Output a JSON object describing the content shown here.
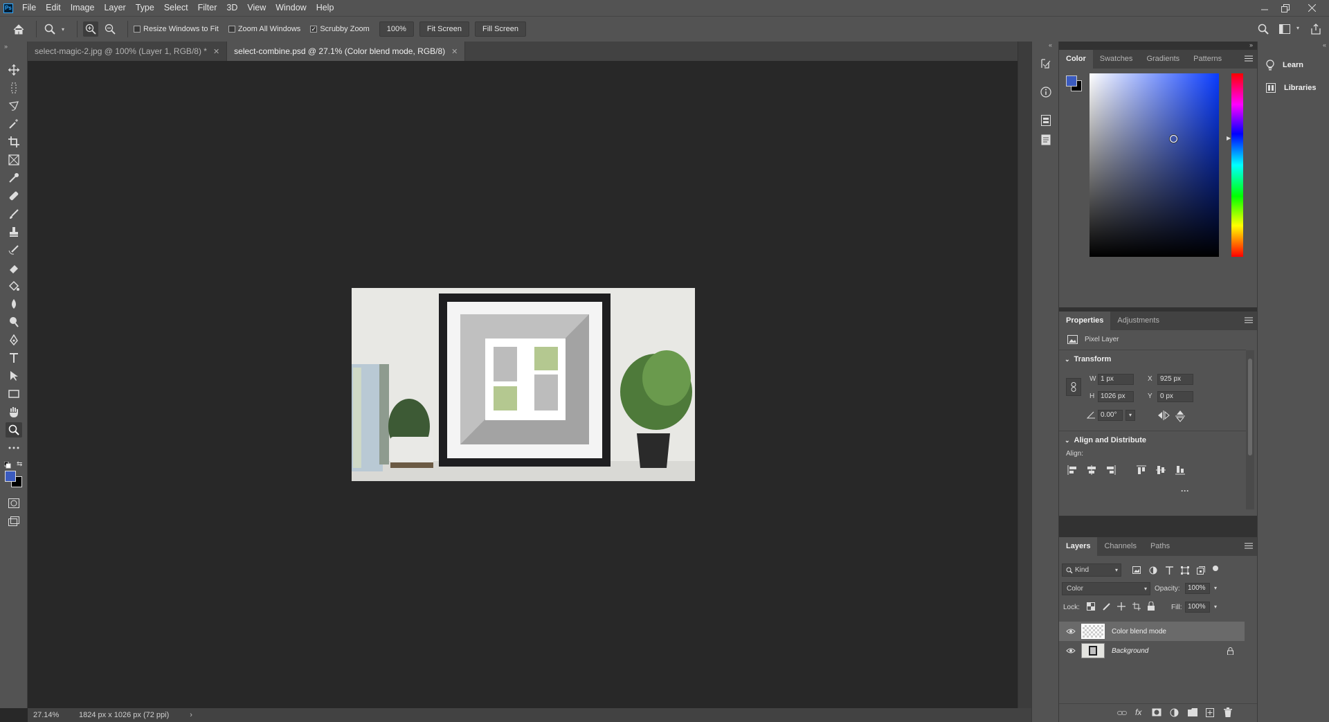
{
  "menubar": {
    "logo": "Ps",
    "items": [
      "File",
      "Edit",
      "Image",
      "Layer",
      "Type",
      "Select",
      "Filter",
      "3D",
      "View",
      "Window",
      "Help"
    ]
  },
  "options": {
    "resize_windows": "Resize Windows to Fit",
    "zoom_all": "Zoom All Windows",
    "scrubby_zoom": "Scrubby Zoom",
    "zoom_value": "100%",
    "fit_screen": "Fit Screen",
    "fill_screen": "Fill Screen",
    "scrubby_checked": true
  },
  "tabs": [
    {
      "label": "select-magic-2.jpg @ 100% (Layer 1, RGB/8) *",
      "active": false
    },
    {
      "label": "select-combine.psd @ 27.1% (Color blend mode, RGB/8)",
      "active": true
    }
  ],
  "status": {
    "zoom": "27.14%",
    "doc_size": "1824 px x 1026 px (72 ppi)"
  },
  "color_panel": {
    "tabs": [
      "Color",
      "Swatches",
      "Gradients",
      "Patterns"
    ],
    "fg_color": "#3b5bbf",
    "bg_color": "#000000"
  },
  "properties_panel": {
    "tabs": [
      "Properties",
      "Adjustments"
    ],
    "layer_type": "Pixel Layer",
    "transform_title": "Transform",
    "w_label": "W",
    "w_value": "1 px",
    "h_label": "H",
    "h_value": "1026 px",
    "x_label": "X",
    "x_value": "925 px",
    "y_label": "Y",
    "y_value": "0 px",
    "angle_value": "0.00°",
    "align_title": "Align and Distribute",
    "align_label": "Align:",
    "more": "···"
  },
  "layers_panel": {
    "tabs": [
      "Layers",
      "Channels",
      "Paths"
    ],
    "filter_kind": "Kind",
    "blend_mode": "Color",
    "opacity_label": "Opacity:",
    "opacity_value": "100%",
    "lock_label": "Lock:",
    "fill_label": "Fill:",
    "fill_value": "100%",
    "layers": [
      {
        "name": "Color blend mode",
        "selected": true,
        "italic": false,
        "locked": false
      },
      {
        "name": "Background",
        "selected": false,
        "italic": true,
        "locked": true
      }
    ]
  },
  "right_panel": {
    "learn": "Learn",
    "libraries": "Libraries"
  }
}
